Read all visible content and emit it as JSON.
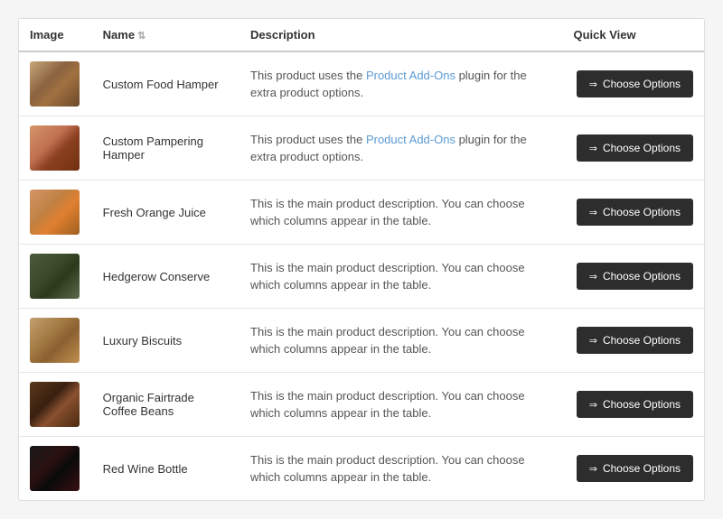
{
  "table": {
    "columns": [
      {
        "id": "image",
        "label": "Image",
        "sortable": false
      },
      {
        "id": "name",
        "label": "Name",
        "sortable": true
      },
      {
        "id": "description",
        "label": "Description",
        "sortable": false
      },
      {
        "id": "quickview",
        "label": "Quick View",
        "sortable": false
      }
    ],
    "rows": [
      {
        "id": 1,
        "image_class": "img-food-hamper",
        "name": "Custom Food Hamper",
        "description_text": "This product uses the ",
        "description_link": "Product Add-Ons",
        "description_suffix": " plugin for the extra product options.",
        "has_link": true,
        "button_label": "Choose Options"
      },
      {
        "id": 2,
        "image_class": "img-pamper-hamper",
        "name": "Custom Pampering Hamper",
        "description_text": "This product uses the ",
        "description_link": "Product Add-Ons",
        "description_suffix": " plugin for the extra product options.",
        "has_link": true,
        "button_label": "Choose Options"
      },
      {
        "id": 3,
        "image_class": "img-orange-juice",
        "name": "Fresh Orange Juice",
        "description_text": "This is the main product description. You can choose which columns appear in the table.",
        "has_link": false,
        "button_label": "Choose Options"
      },
      {
        "id": 4,
        "image_class": "img-hedgerow",
        "name": "Hedgerow Conserve",
        "description_text": "This is the main product description. You can choose which columns appear in the table.",
        "has_link": false,
        "button_label": "Choose Options"
      },
      {
        "id": 5,
        "image_class": "img-luxury-biscuits",
        "name": "Luxury Biscuits",
        "description_text": "This is the main product description. You can choose which columns appear in the table.",
        "has_link": false,
        "button_label": "Choose Options"
      },
      {
        "id": 6,
        "image_class": "img-coffee-beans",
        "name": "Organic Fairtrade Coffee Beans",
        "description_text": "This is the main product description. You can choose which columns appear in the table.",
        "has_link": false,
        "button_label": "Choose Options"
      },
      {
        "id": 7,
        "image_class": "img-red-wine",
        "name": "Red Wine Bottle",
        "description_text": "This is the main product description. You can choose which columns appear in the table.",
        "has_link": false,
        "button_label": "Choose Options"
      }
    ]
  }
}
